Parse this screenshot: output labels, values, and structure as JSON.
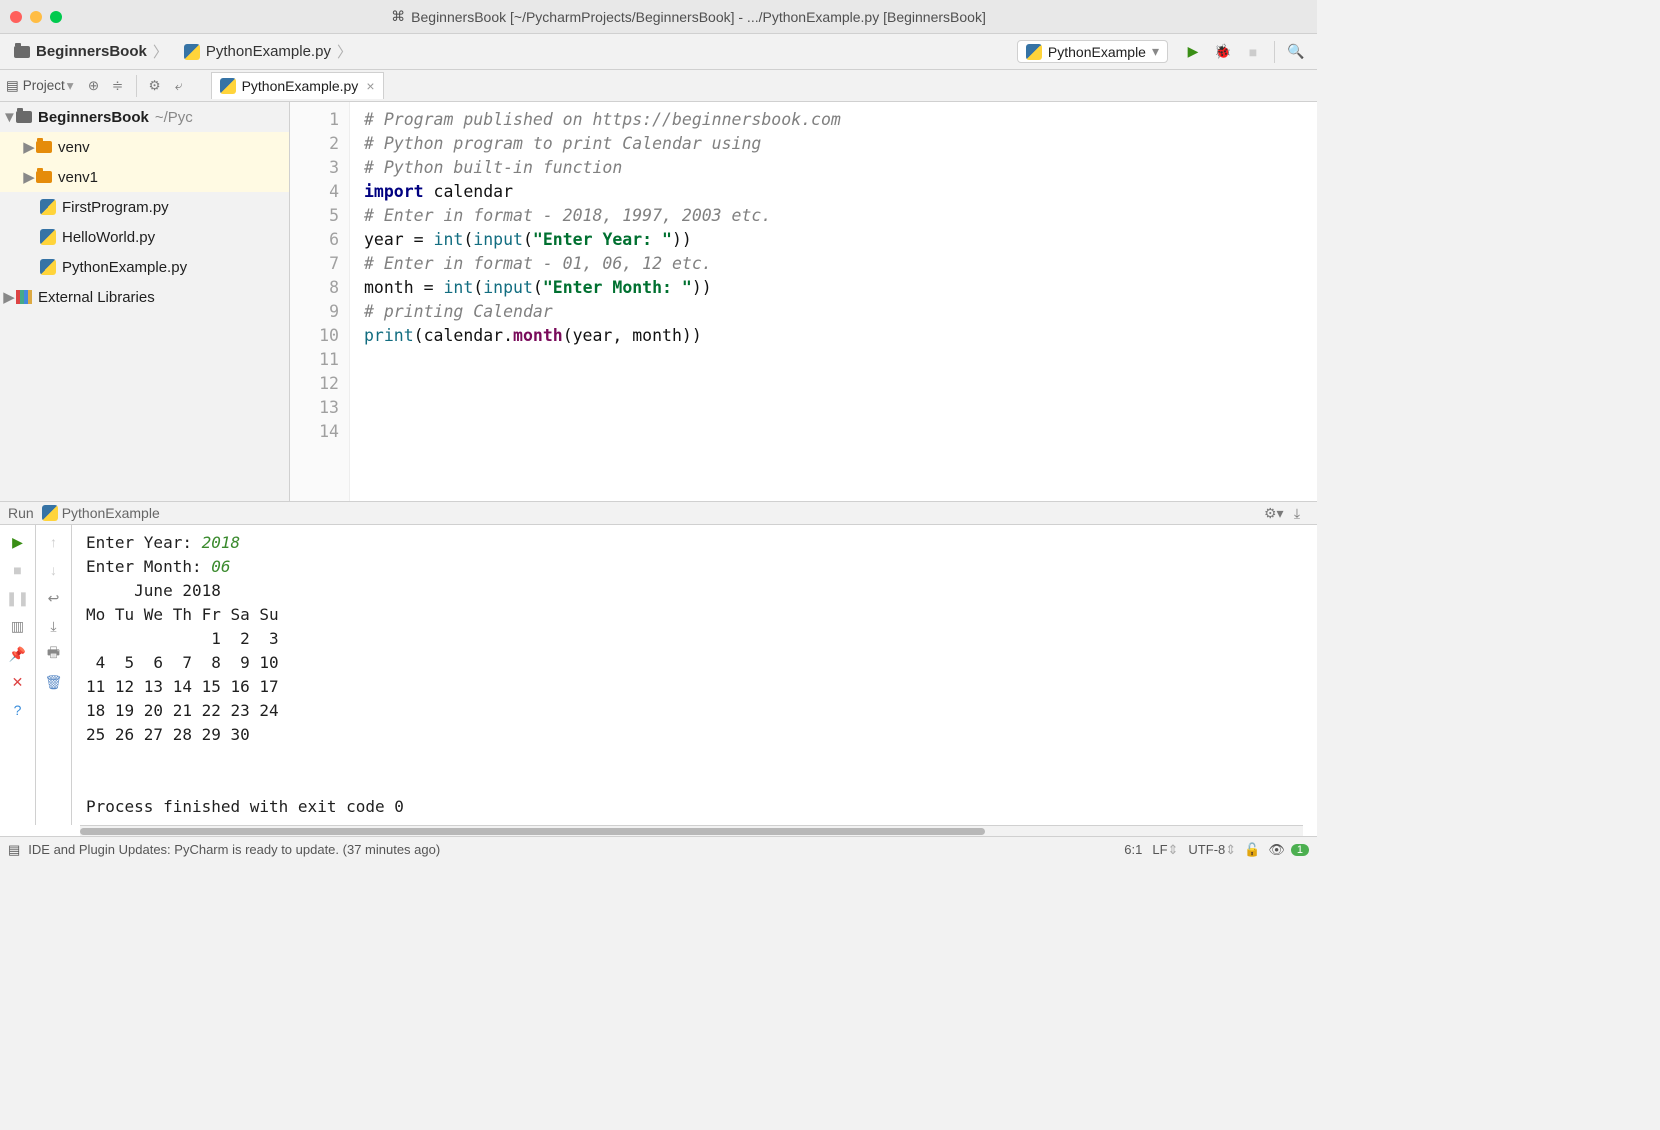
{
  "titlebar": {
    "title": "BeginnersBook [~/PycharmProjects/BeginnersBook] - .../PythonExample.py [BeginnersBook]"
  },
  "breadcrumbs": {
    "project": "BeginnersBook",
    "file": "PythonExample.py"
  },
  "run_config": {
    "selected": "PythonExample"
  },
  "toolbar": {
    "project_label": "Project",
    "tab": {
      "label": "PythonExample.py"
    }
  },
  "tree": {
    "root": {
      "name": "BeginnersBook",
      "path_suffix": "~/Pyc"
    },
    "items": [
      {
        "name": "venv",
        "kind": "folder"
      },
      {
        "name": "venv1",
        "kind": "folder"
      },
      {
        "name": "FirstProgram.py",
        "kind": "py"
      },
      {
        "name": "HelloWorld.py",
        "kind": "py"
      },
      {
        "name": "PythonExample.py",
        "kind": "py"
      }
    ],
    "external": "External Libraries"
  },
  "editor": {
    "line_count": 14,
    "cursor_line": 6,
    "lines": [
      [
        {
          "t": "# Program published on https://beginnersbook.com",
          "c": "c-comment"
        }
      ],
      [
        {
          "t": "# Python program to print Calendar using",
          "c": "c-comment"
        }
      ],
      [
        {
          "t": "# Python built-in function",
          "c": "c-comment"
        }
      ],
      [
        {
          "t": "",
          "c": "c-norm"
        }
      ],
      [
        {
          "t": "import",
          "c": "c-kw"
        },
        {
          "t": " calendar",
          "c": "c-norm"
        }
      ],
      [
        {
          "t": "",
          "c": "c-norm"
        }
      ],
      [
        {
          "t": "# Enter in format - 2018, 1997, 2003 etc.",
          "c": "c-comment"
        }
      ],
      [
        {
          "t": "year = ",
          "c": "c-norm"
        },
        {
          "t": "int",
          "c": "c-fn"
        },
        {
          "t": "(",
          "c": "c-norm"
        },
        {
          "t": "input",
          "c": "c-fn"
        },
        {
          "t": "(",
          "c": "c-norm"
        },
        {
          "t": "\"Enter Year: \"",
          "c": "c-str"
        },
        {
          "t": "))",
          "c": "c-norm"
        }
      ],
      [
        {
          "t": "",
          "c": "c-norm"
        }
      ],
      [
        {
          "t": "# Enter in format - 01, 06, 12 etc.",
          "c": "c-comment"
        }
      ],
      [
        {
          "t": "month = ",
          "c": "c-norm"
        },
        {
          "t": "int",
          "c": "c-fn"
        },
        {
          "t": "(",
          "c": "c-norm"
        },
        {
          "t": "input",
          "c": "c-fn"
        },
        {
          "t": "(",
          "c": "c-norm"
        },
        {
          "t": "\"Enter Month: \"",
          "c": "c-str"
        },
        {
          "t": "))",
          "c": "c-norm"
        }
      ],
      [
        {
          "t": "",
          "c": "c-norm"
        }
      ],
      [
        {
          "t": "# printing Calendar",
          "c": "c-comment"
        }
      ],
      [
        {
          "t": "print",
          "c": "c-fn"
        },
        {
          "t": "(calendar.",
          "c": "c-norm"
        },
        {
          "t": "month",
          "c": "c-mag"
        },
        {
          "t": "(year, month))",
          "c": "c-norm"
        }
      ]
    ]
  },
  "run_panel": {
    "label": "Run",
    "config": "PythonExample",
    "output_lines": [
      [
        {
          "t": "Enter Year: "
        },
        {
          "t": "2018",
          "c": "inpv"
        }
      ],
      [
        {
          "t": "Enter Month: "
        },
        {
          "t": "06",
          "c": "inpv"
        }
      ],
      [
        {
          "t": "     June 2018"
        }
      ],
      [
        {
          "t": "Mo Tu We Th Fr Sa Su"
        }
      ],
      [
        {
          "t": "             1  2  3"
        }
      ],
      [
        {
          "t": " 4  5  6  7  8  9 10"
        }
      ],
      [
        {
          "t": "11 12 13 14 15 16 17"
        }
      ],
      [
        {
          "t": "18 19 20 21 22 23 24"
        }
      ],
      [
        {
          "t": "25 26 27 28 29 30"
        }
      ],
      [
        {
          "t": ""
        }
      ],
      [
        {
          "t": ""
        }
      ],
      [
        {
          "t": "Process finished with exit code 0"
        }
      ]
    ]
  },
  "status": {
    "message": "IDE and Plugin Updates: PyCharm is ready to update. (37 minutes ago)",
    "caret": "6:1",
    "line_sep": "LF",
    "encoding": "UTF-8",
    "badge": "1"
  }
}
